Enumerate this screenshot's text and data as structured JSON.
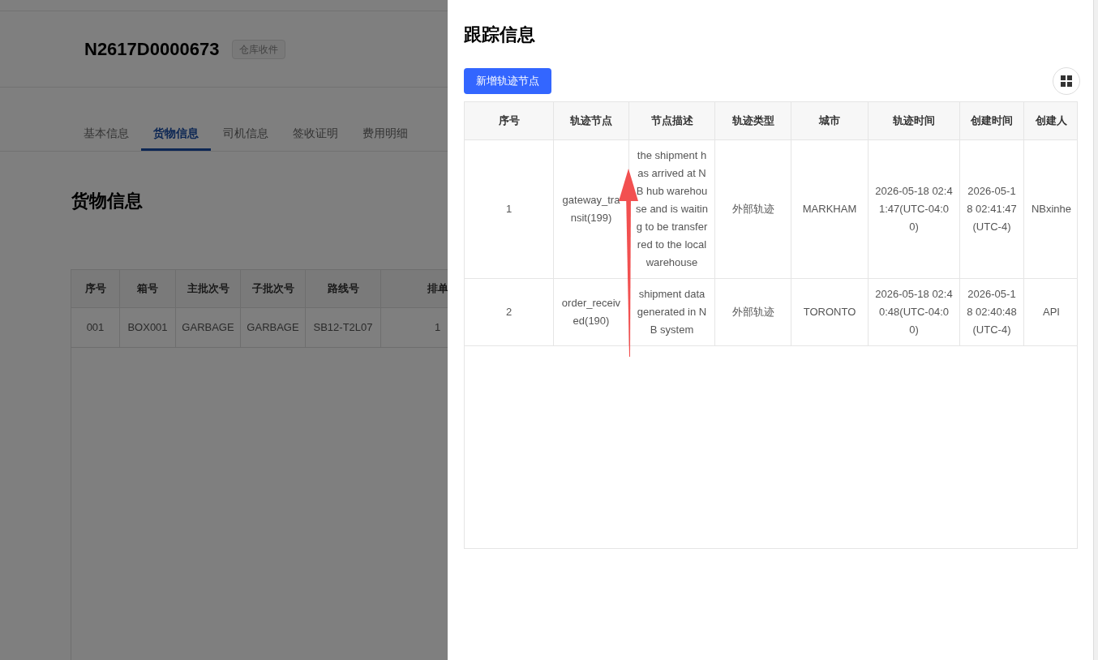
{
  "page": {
    "order_no": "N2617D0000673",
    "status_badge": "仓库收件",
    "tabs": [
      {
        "label": "基本信息",
        "selected": false
      },
      {
        "label": "货物信息",
        "selected": true
      },
      {
        "label": "司机信息",
        "selected": false
      },
      {
        "label": "签收证明",
        "selected": false
      },
      {
        "label": "费用明细",
        "selected": false
      }
    ],
    "section_title": "货物信息",
    "table": {
      "columns": [
        "序号",
        "箱号",
        "主批次号",
        "子批次号",
        "路线号",
        "排单"
      ],
      "rows": [
        [
          "001",
          "BOX001",
          "GARBAGE",
          "GARBAGE",
          "SB12-T2L07",
          "1"
        ]
      ]
    }
  },
  "drawer": {
    "title": "跟踪信息",
    "add_button": "新增轨迹节点",
    "table": {
      "columns": [
        "序号",
        "轨迹节点",
        "节点描述",
        "轨迹类型",
        "城市",
        "轨迹时间",
        "创建时间",
        "创建人"
      ],
      "rows": [
        [
          "1",
          "gateway_transit(199)",
          "the shipment has arrived at NB hub warehouse and is waiting to be transferred to the local warehouse",
          "外部轨迹",
          "MARKHAM",
          "2026-05-18 02:41:47(UTC-04:00)",
          "2026-05-18 02:41:47(UTC-4)",
          "NBxinhe"
        ],
        [
          "2",
          "order_received(190)",
          "shipment data generated in NB system",
          "外部轨迹",
          "TORONTO",
          "2026-05-18 02:40:48(UTC-04:00)",
          "2026-05-18 02:40:48(UTC-4)",
          "API"
        ]
      ]
    }
  }
}
